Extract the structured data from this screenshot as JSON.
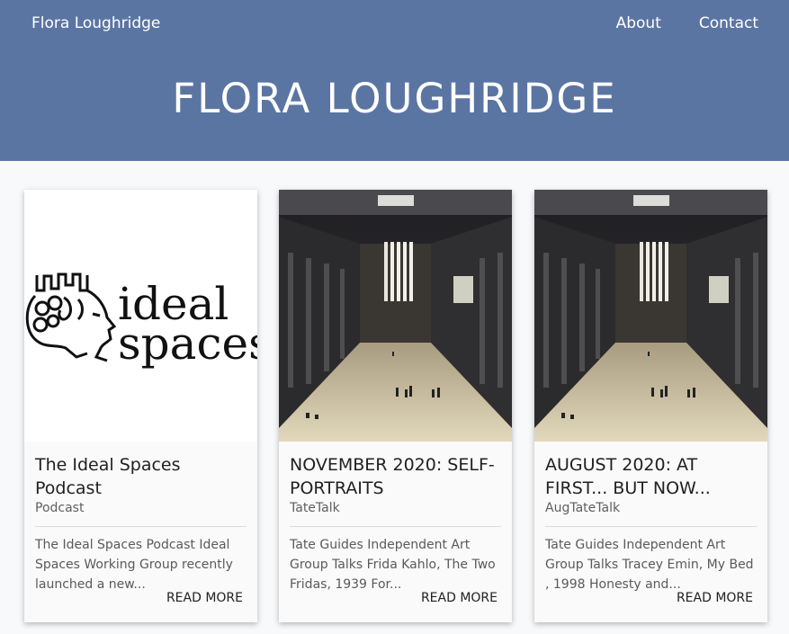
{
  "site": {
    "brand": "Flora Loughridge",
    "nav": [
      "About",
      "Contact"
    ],
    "hero_title": "FLORA LOUGHRIDGE"
  },
  "cards": [
    {
      "title": "The Ideal Spaces Podcast",
      "category": "Podcast",
      "excerpt": "The Ideal Spaces Podcast Ideal Spaces Working Group recently launched a new...",
      "more": "READ MORE",
      "logo_text_1": "ideal",
      "logo_text_2": "spaces"
    },
    {
      "title": "NOVEMBER 2020: SELF-PORTRAITS",
      "category": "TateTalk",
      "excerpt": "Tate Guides Independent Art Group Talks Frida Kahlo, The Two Fridas, 1939 For...",
      "more": "READ MORE"
    },
    {
      "title": "AUGUST 2020: AT FIRST... BUT NOW...",
      "category": "AugTateTalk",
      "excerpt": "Tate Guides Independent Art Group Talks Tracey Emin, My Bed , 1998 Honesty and...",
      "more": "READ MORE"
    }
  ],
  "colors": {
    "header_bg": "#5b75a3",
    "page_bg": "#f8f9fa",
    "card_bg": "#fafafa"
  }
}
